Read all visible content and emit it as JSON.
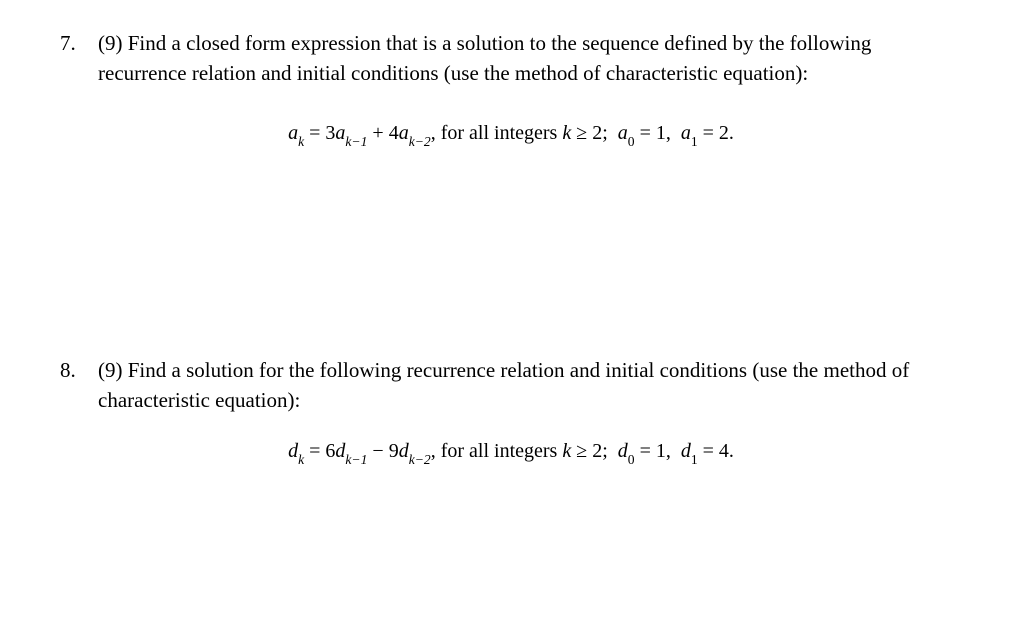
{
  "problems": [
    {
      "number": "7.",
      "points": "(9)",
      "text_before_points": "",
      "text_after_points": " Find a closed form expression that is a solution to the sequence defined by the following recurrence relation and initial conditions (use the method of characteristic equation):",
      "equation": {
        "var": "a",
        "coeff1": "3",
        "coeff2_sign": "+",
        "coeff2": "4",
        "mid_text": " for all integers  ",
        "cond_var": "k",
        "cond_sym": "≥",
        "cond_val": "2;",
        "init0_sub": "0",
        "init0_val": "1,",
        "init1_sub": "1",
        "init1_val": "2."
      }
    },
    {
      "number": "8.",
      "points": "(9)",
      "text_after_points": " Find a solution for the following recurrence relation and initial conditions (use the method of characteristic equation):",
      "equation": {
        "var": "d",
        "coeff1": "6",
        "coeff2_sign": "−",
        "coeff2": "9",
        "mid_text": " for all integers  ",
        "cond_var": "k",
        "cond_sym": "≥",
        "cond_val": "2;",
        "init0_sub": "0",
        "init0_val": "1,",
        "init1_sub": "1",
        "init1_val": "4."
      }
    }
  ],
  "eq_parts": {
    "eq": " = ",
    "k": "k",
    "km1": "k−1",
    "km2": "k−2",
    "comma": ","
  }
}
